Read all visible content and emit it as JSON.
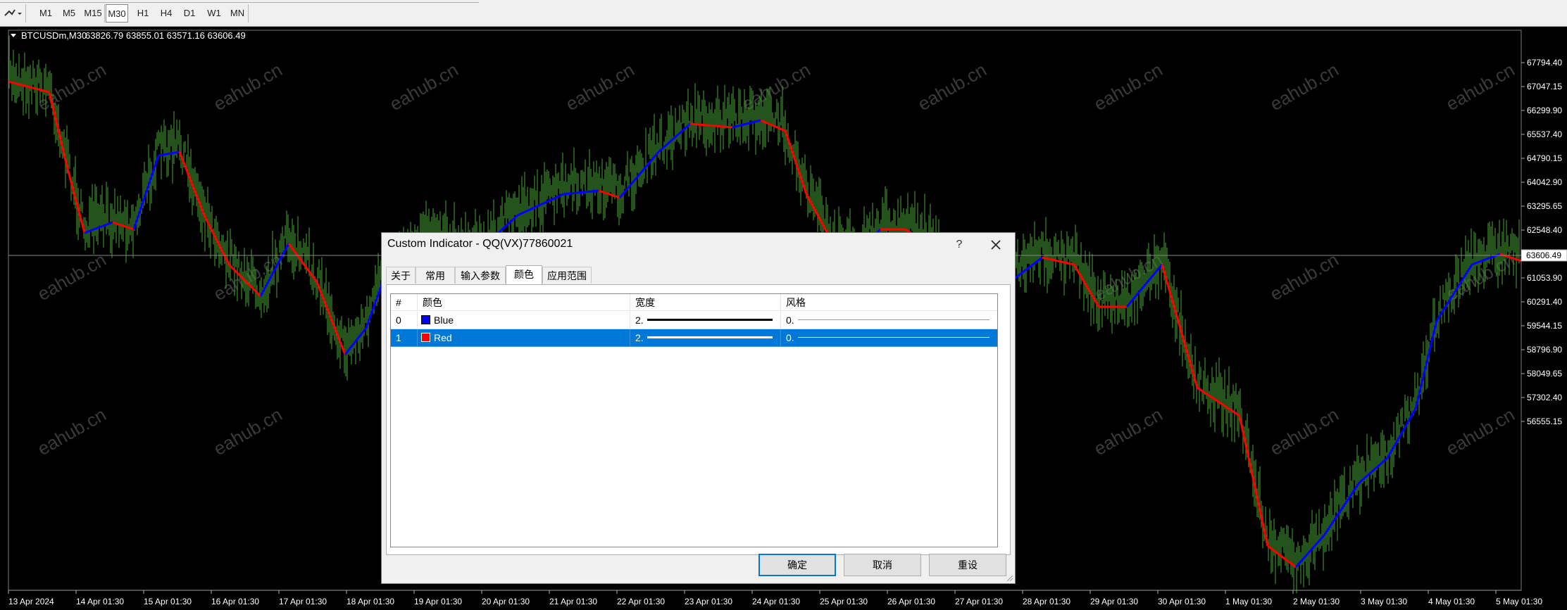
{
  "toolbar": {
    "timeframes": [
      "M1",
      "M5",
      "M15",
      "M30",
      "H1",
      "H4",
      "D1",
      "W1",
      "MN"
    ],
    "active": "M30"
  },
  "chart": {
    "symbol_header": "BTCUSDm,M30",
    "ohlc": "63826.79 63855.01 63571.16 63606.49",
    "current_price": "63606.49",
    "price_labels": [
      "67794.40",
      "67047.15",
      "66299.90",
      "65537.40",
      "64790.15",
      "64042.90",
      "63295.65",
      "62548.40",
      "61801.15",
      "61053.90",
      "60291.40",
      "59544.15",
      "58796.90",
      "58049.65",
      "57302.40",
      "56555.15"
    ],
    "time_labels": [
      "13 Apr 2024",
      "14 Apr 01:30",
      "15 Apr 01:30",
      "16 Apr 01:30",
      "17 Apr 01:30",
      "18 Apr 01:30",
      "19 Apr 01:30",
      "20 Apr 01:30",
      "21 Apr 01:30",
      "22 Apr 01:30",
      "23 Apr 01:30",
      "24 Apr 01:30",
      "25 Apr 01:30",
      "26 Apr 01:30",
      "27 Apr 01:30",
      "28 Apr 01:30",
      "29 Apr 01:30",
      "30 Apr 01:30",
      "1 May 01:30",
      "2 May 01:30",
      "3 May 01:30",
      "4 May 01:30",
      "5 May 01:30"
    ],
    "watermark": "eahub.cn",
    "colors": {
      "bars": "#3c8a2e",
      "ma_up": "#0000ff",
      "ma_down": "#ff0000",
      "price_line": "#888888"
    }
  },
  "dialog": {
    "title": "Custom Indicator - QQ(VX)77860021",
    "help": "?",
    "tabs": [
      "关于",
      "常用",
      "输入参数",
      "颜色",
      "应用范围"
    ],
    "active_tab": "颜色",
    "columns": [
      "#",
      "颜色",
      "宽度",
      "风格"
    ],
    "rows": [
      {
        "index": "0",
        "color_name": "Blue",
        "color": "#0000ff",
        "width": "2.",
        "style": "0."
      },
      {
        "index": "1",
        "color_name": "Red",
        "color": "#ff0000",
        "width": "2.",
        "style": "0.",
        "selected": true
      }
    ],
    "buttons": {
      "ok": "确定",
      "cancel": "取消",
      "reset": "重设"
    }
  }
}
